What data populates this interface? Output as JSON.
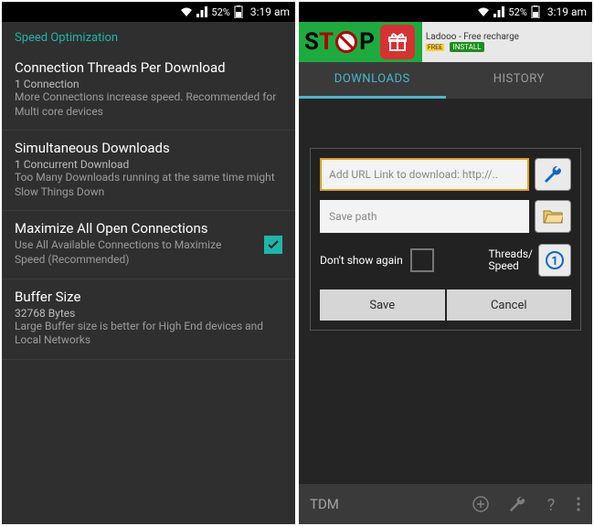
{
  "status": {
    "battery_pct": "52%",
    "time": "3:19 am"
  },
  "left": {
    "section_title": "Speed Optimization",
    "items": [
      {
        "title": "Connection Threads Per Download",
        "value": "1 Connection",
        "desc": "More Connections increase speed. Recommended for Multi core devices"
      },
      {
        "title": "Simultaneous Downloads",
        "value": "1 Concurrent Download",
        "desc": "Too Many Downloads running at the same time might Slow Things Down"
      },
      {
        "title": "Maximize All Open Connections",
        "desc": "Use All Available Connections to Maximize Speed (Recommended)",
        "checked": true
      },
      {
        "title": "Buffer Size",
        "value": "32768 Bytes",
        "desc": "Large Buffer size is better for High End devices and Local Networks"
      }
    ]
  },
  "right": {
    "ad": {
      "text": "Ladooo - Free recharge",
      "free": "FREE",
      "install": "INSTALL"
    },
    "tabs": {
      "downloads": "DOWNLOADS",
      "history": "HISTORY"
    },
    "dialog": {
      "url_placeholder": "Add URL Link to download: http://..",
      "path_placeholder": "Save path",
      "dont_show": "Don't show again",
      "threads_label": "Threads/\nSpeed",
      "save": "Save",
      "cancel": "Cancel"
    },
    "bottom": {
      "title": "TDM"
    }
  }
}
